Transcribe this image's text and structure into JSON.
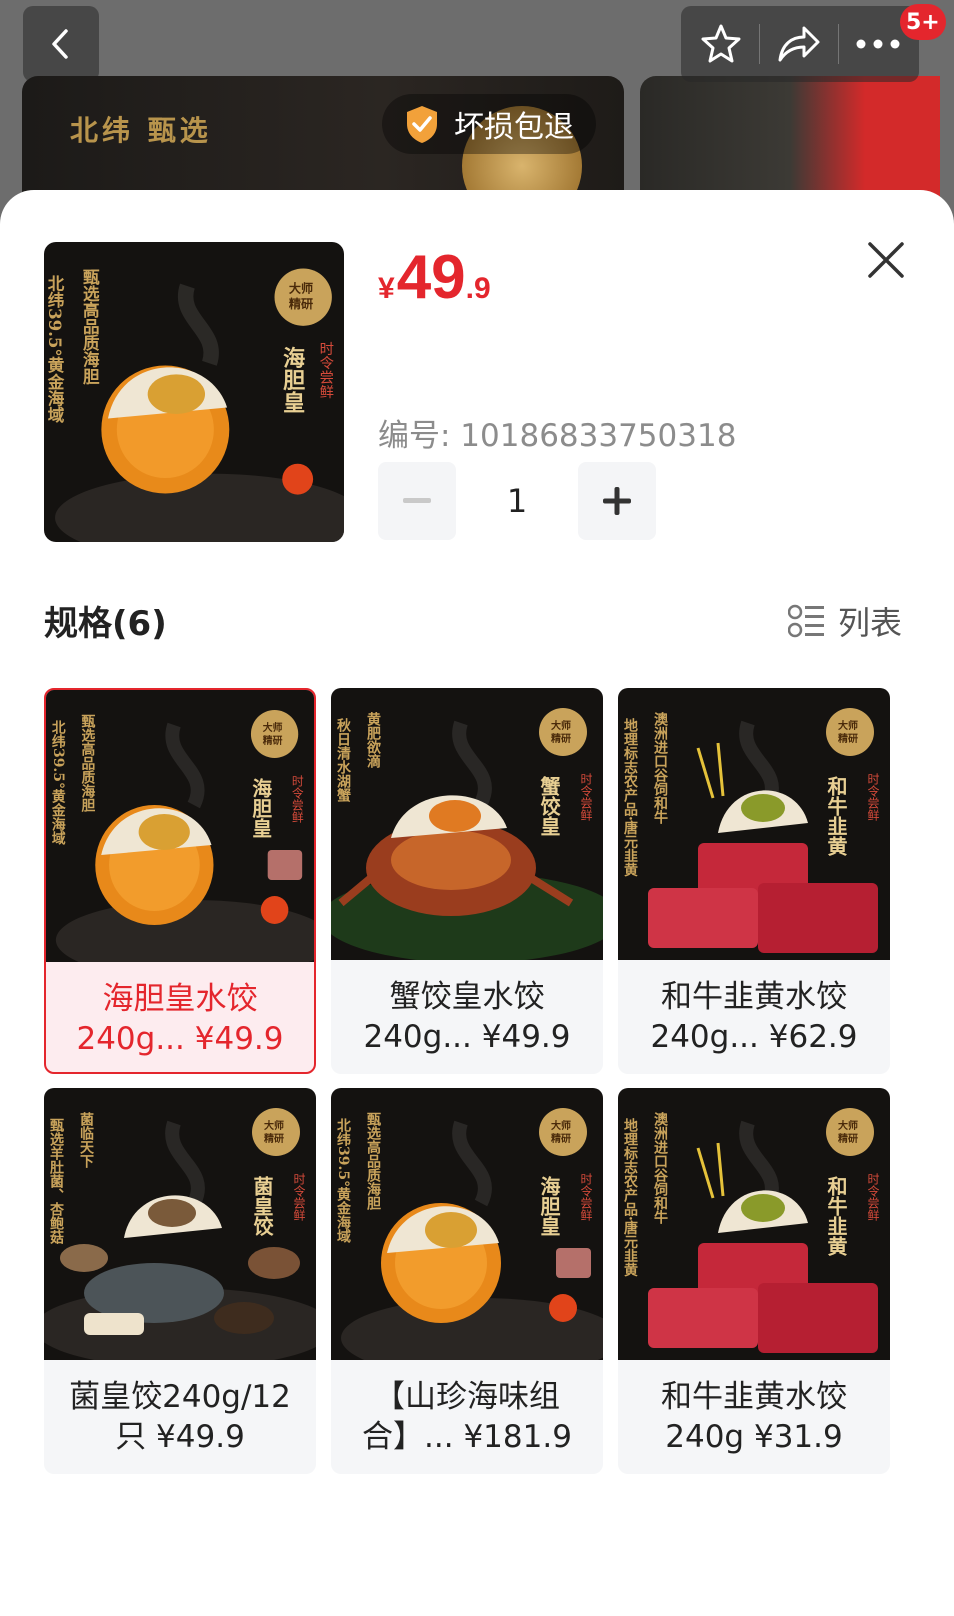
{
  "header": {
    "back_icon": "chevron-left-icon",
    "favorite_icon": "star-icon",
    "share_icon": "share-icon",
    "more_icon": "more-dots-icon",
    "notification_badge": "5+",
    "banner_text": [
      "北纬",
      "甄选"
    ],
    "guarantee_label": "坏损包退"
  },
  "product": {
    "currency": "¥",
    "price_int": "49",
    "price_dec": ".9",
    "sku_label": "编号: 10186833750318",
    "quantity": "1",
    "minus": "−",
    "plus": "+"
  },
  "spec": {
    "title": "规格(6)",
    "view_toggle": "列表",
    "items": [
      {
        "line1": "海胆皇水饺",
        "line2": "240g... ¥49.9",
        "selected": true,
        "theme": "urchin",
        "tag": "海胆皇",
        "side": "甄选高品质海胆",
        "side2": "北纬39.5°黄金海域"
      },
      {
        "line1": "蟹饺皇水饺",
        "line2": "240g... ¥49.9",
        "selected": false,
        "theme": "crab",
        "tag": "蟹饺皇",
        "side": "黄肥欲滴",
        "side2": "秋日清水湖蟹"
      },
      {
        "line1": "和牛韭黄水饺",
        "line2": "240g... ¥62.9",
        "selected": false,
        "theme": "wagyu",
        "tag": "和牛韭黄",
        "side": "澳洲进口谷饲和牛",
        "side2": "地理标志农产品·唐元韭黄"
      },
      {
        "line1": "菌皇饺240g/12",
        "line2": "只 ¥49.9",
        "selected": false,
        "theme": "mushroom",
        "tag": "菌皇饺",
        "side": "菌临天下",
        "side2": "甄选羊肚菌、杏鲍菇"
      },
      {
        "line1": "【山珍海味组",
        "line2": "合】... ¥181.9",
        "selected": false,
        "theme": "urchin",
        "tag": "海胆皇",
        "side": "甄选高品质海胆",
        "side2": "北纬39.5°黄金海域"
      },
      {
        "line1": "和牛韭黄水饺",
        "line2": "240g ¥31.9",
        "selected": false,
        "theme": "wagyu",
        "tag": "和牛韭黄",
        "side": "澳洲进口谷饲和牛",
        "side2": "地理标志农产品·唐元韭黄"
      }
    ]
  },
  "badges": {
    "master": "大师精研",
    "seasonal": "时令尝鲜"
  },
  "colors": {
    "accent": "#e4262d",
    "selected_bg": "#fdecef",
    "gold": "#c9a35b"
  }
}
